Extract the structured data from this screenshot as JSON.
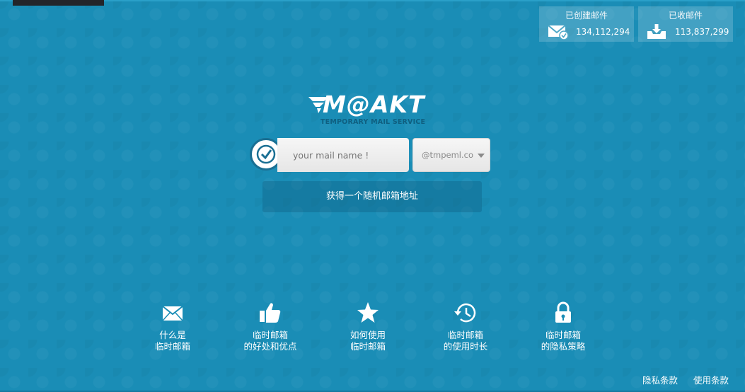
{
  "stats": {
    "created": {
      "label": "已创建邮件",
      "value": "134,112,294",
      "icon": "mail-check-icon"
    },
    "received": {
      "label": "已收邮件",
      "value": "113,837,299",
      "icon": "inbox-download-icon"
    }
  },
  "logo": {
    "word": "M@AKT",
    "tagline": "TEMPORARY MAIL SERVICE"
  },
  "form": {
    "name_placeholder": "your mail name !",
    "domain_value": "@tmpeml.com",
    "random_button": "获得一个随机邮箱地址"
  },
  "features": [
    {
      "line1": "什么是",
      "line2": "临时邮箱",
      "icon": "envelope-icon"
    },
    {
      "line1": "临时邮箱",
      "line2": "的好处和优点",
      "icon": "thumbs-up-icon"
    },
    {
      "line1": "如何使用",
      "line2": "临时邮箱",
      "icon": "star-icon"
    },
    {
      "line1": "临时邮箱",
      "line2": "的使用时长",
      "icon": "history-clock-icon"
    },
    {
      "line1": "临时邮箱",
      "line2": "的隐私策略",
      "icon": "lock-icon"
    }
  ],
  "footer": {
    "privacy": "隐私条款",
    "terms": "使用条款"
  },
  "colors": {
    "background": "#1a8db6",
    "stat_box": "#4fa8c8",
    "button": "#157aa0"
  }
}
